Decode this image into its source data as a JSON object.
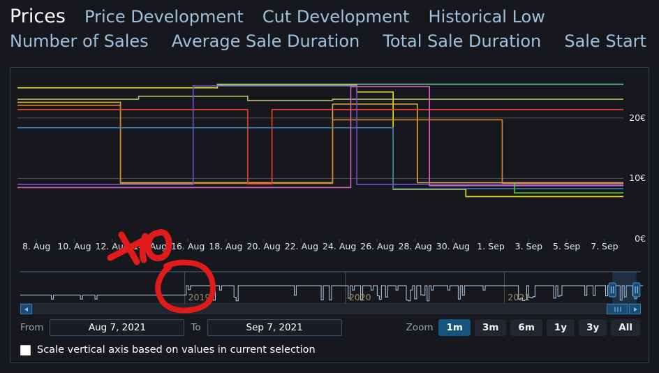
{
  "tabs": {
    "row1": [
      {
        "label": "Prices",
        "active": true
      },
      {
        "label": "Price Development",
        "active": false
      },
      {
        "label": "Cut Development",
        "active": false
      },
      {
        "label": "Historical Low",
        "active": false
      }
    ],
    "row2": [
      {
        "label": "Number of Sales",
        "active": false
      },
      {
        "label": "Average Sale Duration",
        "active": false
      },
      {
        "label": "Total Sale Duration",
        "active": false
      },
      {
        "label": "Sale Start",
        "active": false
      }
    ]
  },
  "chart_data": {
    "type": "line",
    "title": "Prices",
    "xlabel": "",
    "ylabel": "",
    "ylim": [
      0,
      26
    ],
    "grid": true,
    "legend": "none",
    "ytick_labels": [
      "20€",
      "10€",
      "0€"
    ],
    "ytick_values": [
      20,
      10,
      0
    ],
    "xtick_labels": [
      "8. Aug",
      "10. Aug",
      "12. Aug",
      "14. Aug",
      "16. Aug",
      "18. Aug",
      "20. Aug",
      "22. Aug",
      "24. Aug",
      "26. Aug",
      "28. Aug",
      "30. Aug",
      "1. Sep",
      "3. Sep",
      "5. Sep",
      "7. Sep"
    ],
    "x_range": [
      "Aug 7, 2021",
      "Sep 7, 2021"
    ],
    "step_style": "hv",
    "series": [
      {
        "name": "yellow",
        "color": "#f2e312",
        "x": [
          0,
          0.33,
          0.33,
          0.56,
          0.56,
          0.62,
          0.62,
          0.74,
          0.74,
          1.0
        ],
        "values": [
          25.0,
          25.0,
          25.4,
          25.4,
          24.3,
          24.3,
          8.2,
          8.2,
          7.0,
          7.0
        ]
      },
      {
        "name": "green",
        "color": "#74d99f",
        "x": [
          0.33,
          0.33,
          1.0
        ],
        "values": [
          25.4,
          25.6,
          25.6
        ]
      },
      {
        "name": "khaki",
        "color": "#b7b869",
        "x": [
          0,
          0.2,
          0.2,
          0.38,
          0.38,
          0.52,
          0.52,
          1.0
        ],
        "values": [
          23.1,
          23.1,
          23.6,
          23.6,
          22.9,
          22.9,
          23.1,
          23.1
        ]
      },
      {
        "name": "orange-light",
        "color": "#e8a33d",
        "x": [
          0,
          0.17,
          0.17,
          0.52,
          0.52,
          0.66,
          0.66,
          1.0
        ],
        "values": [
          22.6,
          22.6,
          9.3,
          9.3,
          22.3,
          22.3,
          9.3,
          9.3
        ]
      },
      {
        "name": "orange-dark",
        "color": "#d98a28",
        "x": [
          0,
          0.17,
          0.17,
          0.52,
          0.52,
          0.8,
          0.8,
          1.0
        ],
        "values": [
          22.1,
          22.1,
          9.2,
          9.2,
          19.7,
          19.7,
          9.2,
          9.2
        ]
      },
      {
        "name": "red",
        "color": "#e8412e",
        "x": [
          0,
          0.38,
          0.38,
          0.42,
          0.42,
          0.52,
          0.52,
          0.78,
          0.78,
          1.0
        ],
        "values": [
          21.4,
          21.4,
          9.1,
          9.1,
          21.4,
          21.4,
          21.4,
          21.4,
          21.4,
          21.4
        ]
      },
      {
        "name": "steel-blue",
        "color": "#3d7eb8",
        "x": [
          0,
          0.62,
          0.62,
          1.0
        ],
        "values": [
          18.4,
          18.4,
          8.3,
          8.3
        ]
      },
      {
        "name": "violet",
        "color": "#6b52c4",
        "x": [
          0,
          0.29,
          0.29,
          0.56,
          0.56,
          1.0
        ],
        "values": [
          9.0,
          9.0,
          25.3,
          25.3,
          9.0,
          9.0
        ]
      },
      {
        "name": "magenta",
        "color": "#d35fc0",
        "x": [
          0,
          0.55,
          0.55,
          0.68,
          0.68,
          1.0
        ],
        "values": [
          8.5,
          8.5,
          25.2,
          25.2,
          8.8,
          8.8
        ]
      },
      {
        "name": "lime",
        "color": "#55cc2e",
        "x": [
          0.82,
          0.82,
          1.0
        ],
        "values": [
          9.3,
          7.6,
          7.6
        ]
      }
    ]
  },
  "navigator": {
    "year_labels": [
      {
        "text": "2019",
        "position_pct": 26.5
      },
      {
        "text": "2020",
        "position_pct": 52.4
      },
      {
        "text": "2021",
        "position_pct": 78.0
      }
    ],
    "selection_start_pct": 95.4,
    "selection_end_pct": 99.3,
    "scroll_left_arrow": "◀",
    "scroll_right_arrow": "▶"
  },
  "range": {
    "from_label": "From",
    "from_value": "Aug 7, 2021",
    "to_label": "To",
    "to_value": "Sep 7, 2021",
    "zoom_label": "Zoom",
    "zoom_options": [
      {
        "label": "1m",
        "selected": true
      },
      {
        "label": "3m",
        "selected": false
      },
      {
        "label": "6m",
        "selected": false
      },
      {
        "label": "1y",
        "selected": false
      },
      {
        "label": "3y",
        "selected": false
      },
      {
        "label": "All",
        "selected": false
      }
    ]
  },
  "options": {
    "scale_axis_label": "Scale vertical axis based on values in current selection",
    "scale_axis_checked": false
  },
  "annotations": [
    {
      "name": "plus-ten-marker",
      "text": "+10",
      "color": "#e01b1b"
    },
    {
      "name": "circle-2019-marker",
      "text": "",
      "color": "#e01b1b"
    }
  ],
  "colors": {
    "background": "#16181d",
    "panel_border": "#2c4159",
    "tab_link": "#9fc0dd",
    "tab_active": "#ffffff",
    "accent": "#16537e",
    "annotation_red": "#e01b1b"
  }
}
